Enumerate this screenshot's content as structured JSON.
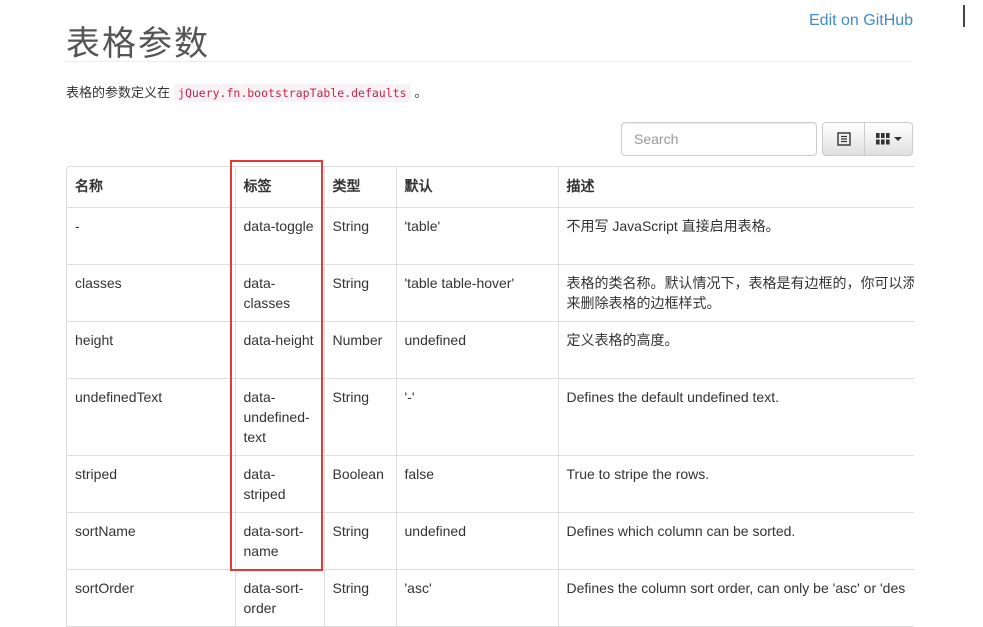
{
  "page": {
    "title": "表格参数",
    "edit_link": "Edit on GitHub"
  },
  "intro": {
    "before": "表格的参数定义在",
    "code": "jQuery.fn.bootstrapTable.defaults",
    "after": "。"
  },
  "toolbar": {
    "search_placeholder": "Search",
    "toggle_icon": "list-icon",
    "columns_icon": "grid-icon"
  },
  "table": {
    "headers": [
      "名称",
      "标签",
      "类型",
      "默认",
      "描述"
    ],
    "rows": [
      {
        "name": "-",
        "tag": "data-toggle",
        "type": "String",
        "default": "'table'",
        "desc": [
          "不用写 JavaScript 直接启用表格。"
        ]
      },
      {
        "name": "classes",
        "tag": "data-classes",
        "type": "String",
        "default": "'table table-hover'",
        "desc": [
          "表格的类名称。默认情况下，表格是有边框的，你可以添",
          "来删除表格的边框样式。"
        ]
      },
      {
        "name": "height",
        "tag": "data-height",
        "type": "Number",
        "default": "undefined",
        "desc": [
          "定义表格的高度。"
        ]
      },
      {
        "name": "undefinedText",
        "tag": "data-undefined-text",
        "type": "String",
        "default": "'-'",
        "desc": [
          "Defines the default undefined text."
        ]
      },
      {
        "name": "striped",
        "tag": "data-striped",
        "type": "Boolean",
        "default": "false",
        "desc": [
          "True to stripe the rows."
        ]
      },
      {
        "name": "sortName",
        "tag": "data-sort-name",
        "type": "String",
        "default": "undefined",
        "desc": [
          "Defines which column can be sorted."
        ]
      },
      {
        "name": "sortOrder",
        "tag": "data-sort-order",
        "type": "String",
        "default": "'asc'",
        "desc": [
          "Defines the column sort order, can only be 'asc' or 'des"
        ]
      }
    ]
  },
  "colors": {
    "link": "#428bca",
    "code": "#c7254e",
    "highlight_box": "#e53935"
  }
}
